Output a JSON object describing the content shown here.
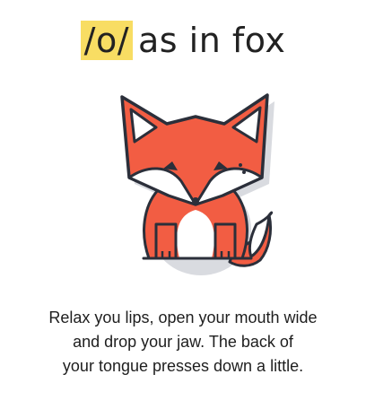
{
  "title": {
    "phoneme": "/o/",
    "rest": "as in fox"
  },
  "illustration": {
    "icon": "fox-icon",
    "colors": {
      "fur": "#f25d43",
      "outline": "#2b2f3a",
      "white": "#ffffff",
      "shadow": "#d9dbe0"
    }
  },
  "caption": {
    "lines": [
      "Relax you lips, open your mouth wide",
      "and drop your jaw. The back of",
      "your tongue presses down a little."
    ]
  },
  "colors": {
    "highlight": "#f8dd63"
  }
}
